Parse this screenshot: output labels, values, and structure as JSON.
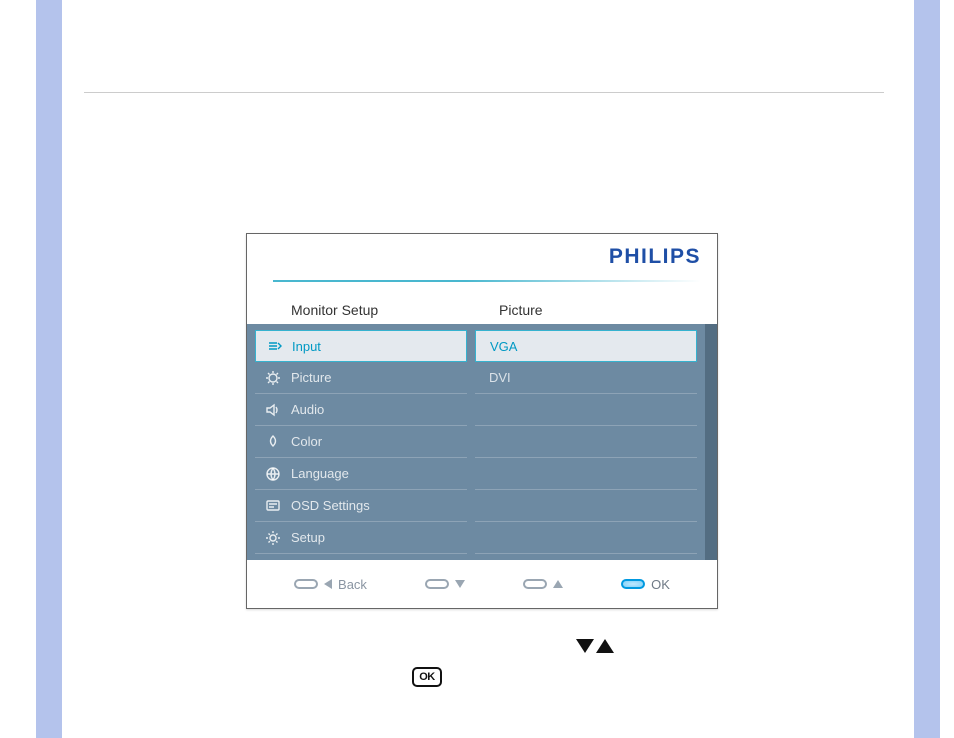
{
  "brand": "PHILIPS",
  "headers": {
    "left": "Monitor Setup",
    "right": "Picture"
  },
  "menu": [
    {
      "icon": "input-icon",
      "label": "Input",
      "selected": true
    },
    {
      "icon": "picture-icon",
      "label": "Picture",
      "selected": false
    },
    {
      "icon": "audio-icon",
      "label": "Audio",
      "selected": false
    },
    {
      "icon": "color-icon",
      "label": "Color",
      "selected": false
    },
    {
      "icon": "language-icon",
      "label": "Language",
      "selected": false
    },
    {
      "icon": "osd-icon",
      "label": "OSD Settings",
      "selected": false
    },
    {
      "icon": "setup-icon",
      "label": "Setup",
      "selected": false
    }
  ],
  "submenu": [
    {
      "label": "VGA",
      "selected": true
    },
    {
      "label": "DVI",
      "selected": false
    }
  ],
  "footer": {
    "back": "Back",
    "ok": "OK"
  },
  "ok_badge": "OK"
}
